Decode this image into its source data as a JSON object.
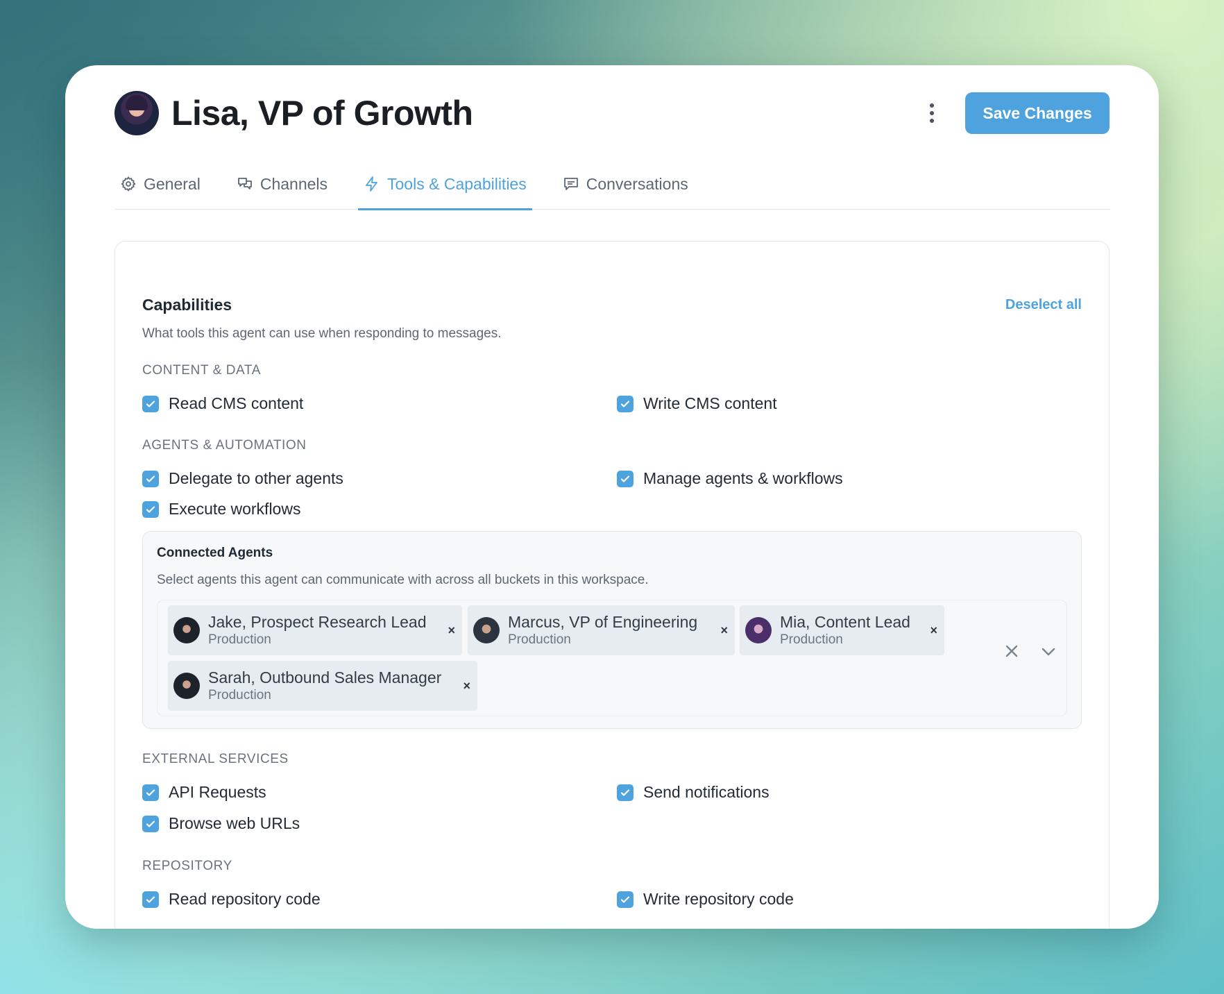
{
  "header": {
    "title": "Lisa, VP of Growth",
    "save_label": "Save Changes"
  },
  "tabs": [
    {
      "label": "General",
      "icon": "gear-icon"
    },
    {
      "label": "Channels",
      "icon": "chat-bubbles-icon"
    },
    {
      "label": "Tools & Capabilities",
      "icon": "lightning-icon",
      "active": true
    },
    {
      "label": "Conversations",
      "icon": "message-icon"
    }
  ],
  "capabilities": {
    "title": "Capabilities",
    "description": "What tools this agent can use when responding to messages.",
    "deselect_label": "Deselect all",
    "sections": {
      "content_data": {
        "label": "CONTENT & DATA",
        "items": [
          "Read CMS content",
          "Write CMS content"
        ]
      },
      "agents_automation": {
        "label": "AGENTS & AUTOMATION",
        "items": [
          "Delegate to other agents",
          "Manage agents & workflows",
          "Execute workflows"
        ]
      },
      "external_services": {
        "label": "EXTERNAL SERVICES",
        "items": [
          "API Requests",
          "Send notifications",
          "Browse web URLs"
        ]
      },
      "repository": {
        "label": "REPOSITORY",
        "items": [
          "Read repository code",
          "Write repository code"
        ]
      }
    }
  },
  "connected_agents": {
    "title": "Connected Agents",
    "description": "Select agents this agent can communicate with across all buckets in this workspace.",
    "agents": [
      {
        "name": "Jake, Prospect Research Lead",
        "env": "Production"
      },
      {
        "name": "Marcus, VP of Engineering",
        "env": "Production"
      },
      {
        "name": "Mia, Content Lead",
        "env": "Production"
      },
      {
        "name": "Sarah, Outbound Sales Manager",
        "env": "Production"
      }
    ],
    "remove_glyph": "×"
  },
  "colors": {
    "accent": "#4ea3de",
    "text": "#1f2933",
    "muted": "#5d6773"
  }
}
